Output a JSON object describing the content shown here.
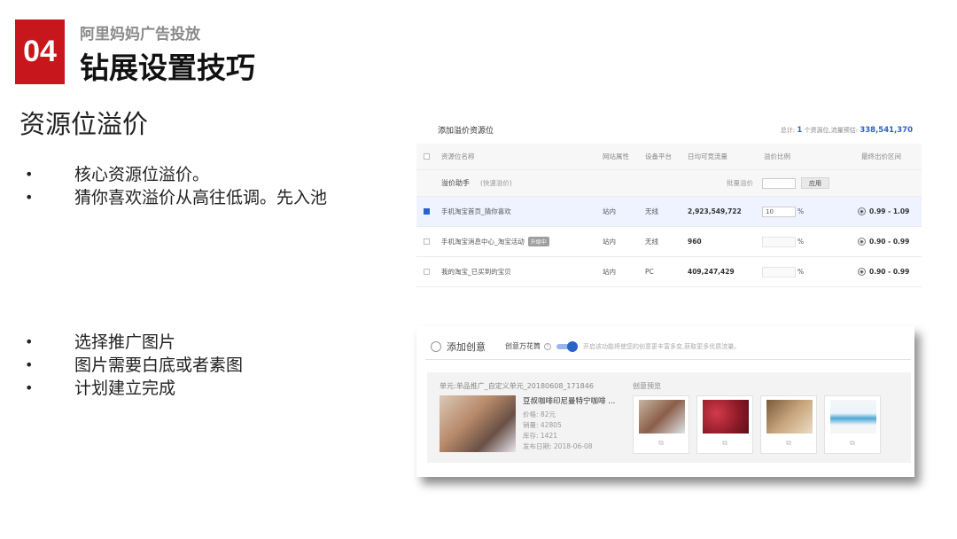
{
  "header": {
    "badge": "04",
    "kicker": "阿里妈妈广告投放",
    "title": "钻展设置技巧"
  },
  "section_title": "资源位溢价",
  "bullets_top": [
    "核心资源位溢价。",
    "猜你喜欢溢价从高往低调。先入池"
  ],
  "bullets_bottom": [
    "选择推广图片",
    "图片需要白底或者素图",
    "计划建立完成"
  ],
  "bullet_symbol": "•",
  "premium_panel": {
    "title": "添加溢价资源位",
    "summary_prefix": "总计:",
    "summary_count": "1",
    "summary_mid": "个资源位,流量预估:",
    "summary_total": "338,541,370",
    "columns": [
      "资源位名称",
      "网站属性",
      "设备平台",
      "日均可竞流量",
      "溢价比例",
      "最终出价区间"
    ],
    "helper": {
      "label": "溢价助手",
      "hint": "(快速溢价)",
      "batch_label": "批量溢价",
      "apply_button": "应用"
    },
    "rows": [
      {
        "name": "手机淘宝首页_猜你喜欢",
        "tag": "",
        "site": "站内",
        "platform": "无线",
        "traffic": "2,923,549,722",
        "premium": "10",
        "unit": "%",
        "range": "0.99 - 1.09",
        "checked": true
      },
      {
        "name": "手机淘宝消息中心_淘宝活动",
        "tag": "升级中",
        "site": "站内",
        "platform": "无线",
        "traffic": "960",
        "premium": "",
        "unit": "%",
        "range": "0.90 - 0.99",
        "checked": false
      },
      {
        "name": "我的淘宝_已买到的宝贝",
        "tag": "",
        "site": "站内",
        "platform": "PC",
        "traffic": "409,247,429",
        "premium": "",
        "unit": "%",
        "range": "0.90 - 0.99",
        "checked": false
      }
    ]
  },
  "creative_panel": {
    "title": "添加创意",
    "kaleidoscope": "创意万花筒",
    "note": "开启该功能将使您的创意更丰富多变,获取更多优质流量。",
    "unit_label": "单元:单品推广_自定义单元_20180608_171846",
    "product_name": "豆叔咖啡印尼曼特宁咖啡 ...",
    "price": "价格: 82元",
    "sales": "销量: 42805",
    "stock": "库存: 1421",
    "date": "发布日期: 2018-06-08",
    "preview_label": "创意预览"
  },
  "colors": {
    "badge": "#c8161d",
    "accent_blue": "#2962c8"
  }
}
